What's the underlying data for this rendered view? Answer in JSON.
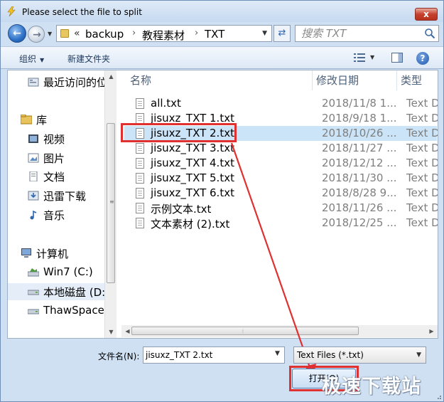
{
  "window": {
    "title": "Please select the file to split",
    "close_label": "x"
  },
  "address": {
    "chevron": "«",
    "crumbs": [
      "backup",
      "教程素材",
      "TXT"
    ],
    "separators": [
      "›",
      "›"
    ]
  },
  "search": {
    "placeholder": "搜索 TXT"
  },
  "toolbar": {
    "organize": "组织",
    "new_folder": "新建文件夹",
    "help": "?"
  },
  "nav": {
    "items": [
      {
        "label": "最近访问的位置",
        "icon": "recent-places-icon"
      },
      {
        "label": "库",
        "icon": "library-icon"
      },
      {
        "label": "视频",
        "icon": "video-icon"
      },
      {
        "label": "图片",
        "icon": "pictures-icon"
      },
      {
        "label": "文档",
        "icon": "documents-icon"
      },
      {
        "label": "迅雷下载",
        "icon": "download-icon"
      },
      {
        "label": "音乐",
        "icon": "music-icon"
      },
      {
        "label": "计算机",
        "icon": "computer-icon"
      },
      {
        "label": "Win7 (C:)",
        "icon": "drive-icon"
      },
      {
        "label": "本地磁盘 (D:)",
        "icon": "drive-icon"
      },
      {
        "label": "ThawSpace",
        "icon": "drive-icon"
      }
    ]
  },
  "columns": {
    "name": "名称",
    "date": "修改日期",
    "type": "类型"
  },
  "files": [
    {
      "name": "all.txt",
      "date": "2018/11/8 1...",
      "type": "Text Do"
    },
    {
      "name": "jisuxz_TXT 1.txt",
      "date": "2018/9/18 1...",
      "type": "Text Do"
    },
    {
      "name": "jisuxz_TXT 2.txt",
      "date": "2018/10/26 ...",
      "type": "Text Do"
    },
    {
      "name": "jisuxz_TXT 3.txt",
      "date": "2018/11/27 ...",
      "type": "Text Do"
    },
    {
      "name": "jisuxz_TXT 4.txt",
      "date": "2018/12/12 ...",
      "type": "Text Do"
    },
    {
      "name": "jisuxz_TXT 5.txt",
      "date": "2018/11/30 ...",
      "type": "Text Do"
    },
    {
      "name": "jisuxz_TXT 6.txt",
      "date": "2018/8/28 9...",
      "type": "Text Do"
    },
    {
      "name": "示例文本.txt",
      "date": "2018/11/26 ...",
      "type": "Text Do"
    },
    {
      "name": "文本素材 (2).txt",
      "date": "2018/12/25 ...",
      "type": "Text Do"
    }
  ],
  "selected_file_index": 2,
  "bottom": {
    "filename_label": "文件名(N):",
    "filename_value": "jisuxz_TXT 2.txt",
    "filetype_value": "Text Files (*.txt)",
    "open_label": "打开(O)"
  },
  "watermark": "极速下载站",
  "colors": {
    "highlight": "#e03030",
    "selection": "#cce4f7"
  }
}
